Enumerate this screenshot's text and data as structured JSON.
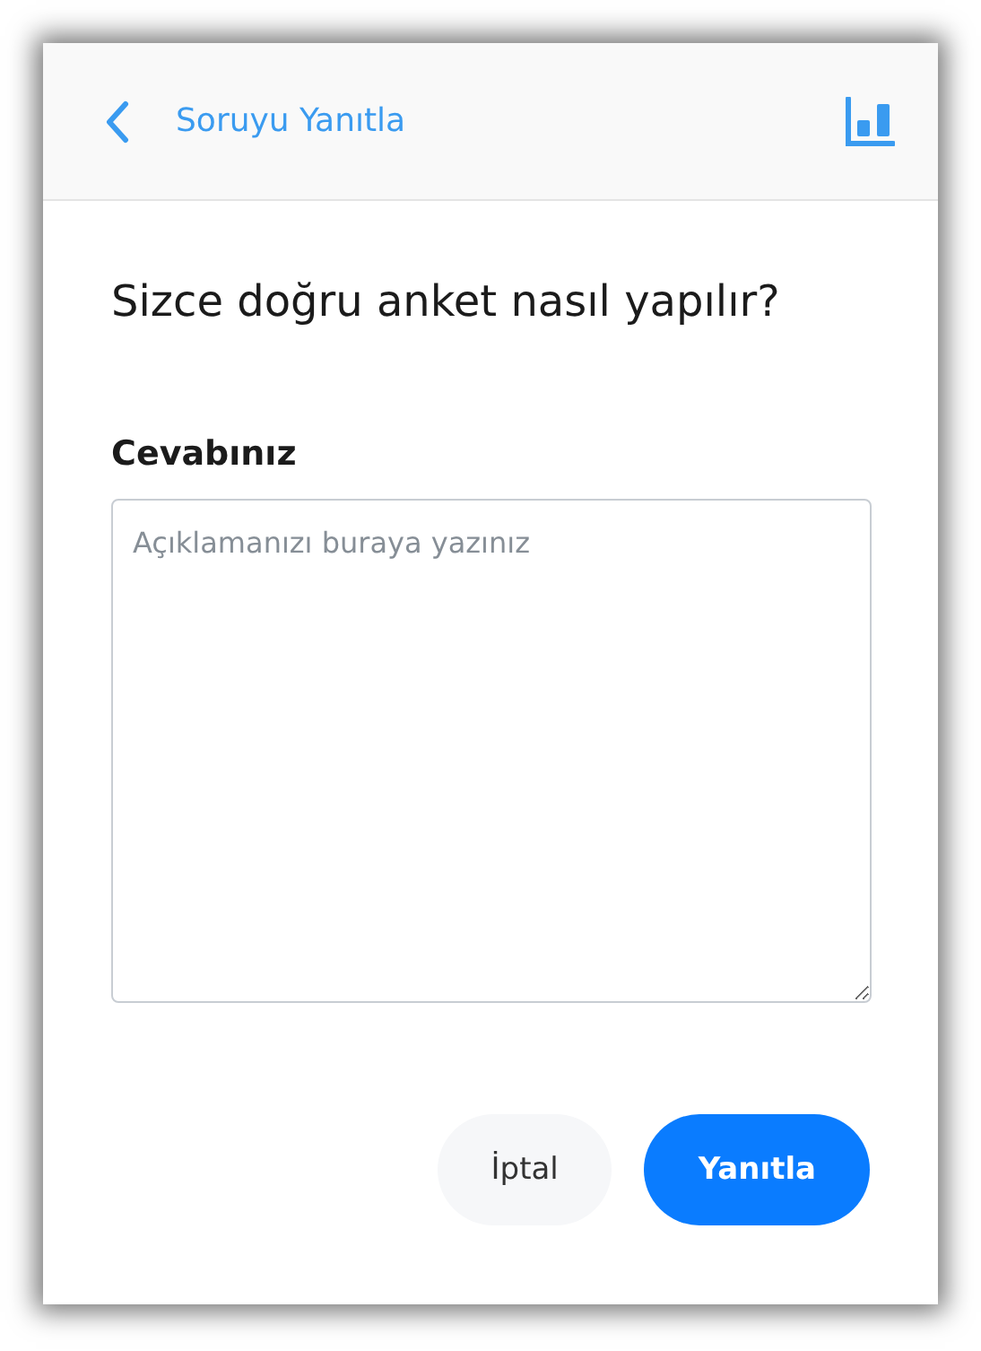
{
  "header": {
    "title": "Soruyu Yanıtla"
  },
  "question": "Sizce doğru anket nasıl yapılır?",
  "answer": {
    "label": "Cevabınız",
    "placeholder": "Açıklamanızı buraya yazınız"
  },
  "buttons": [
    {
      "label": "İptal",
      "kind": "secondary"
    },
    {
      "label": "Yanıtla",
      "kind": "primary"
    }
  ]
}
